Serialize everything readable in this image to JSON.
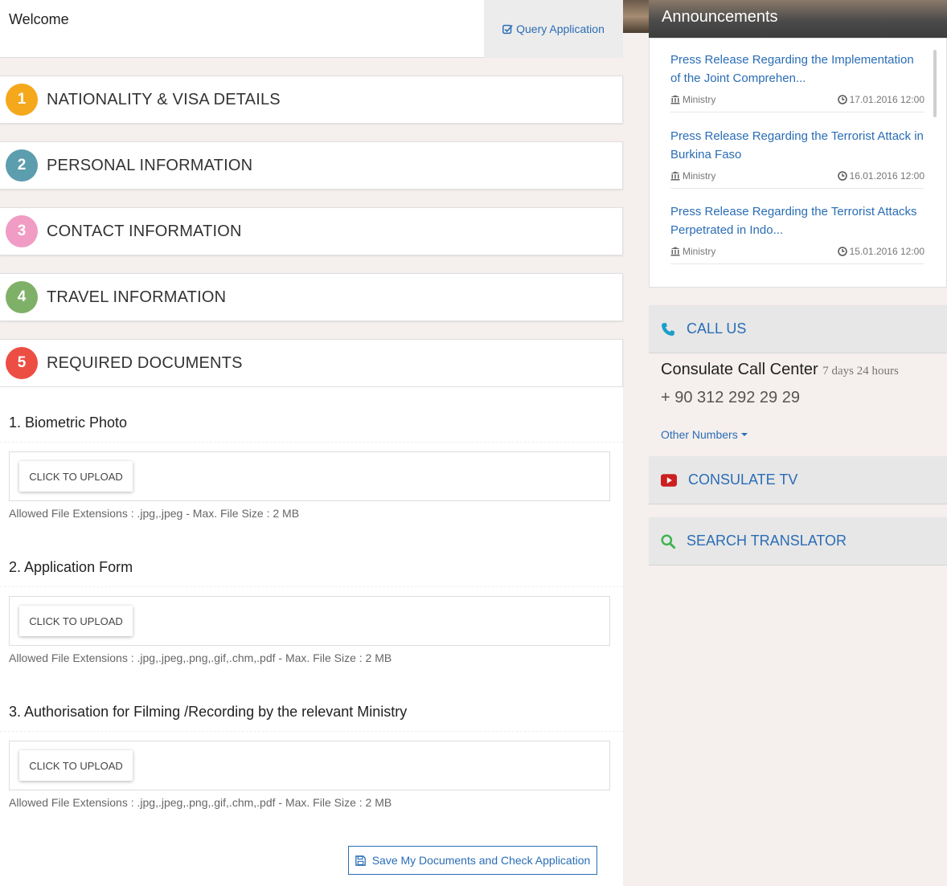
{
  "header": {
    "welcome": "Welcome",
    "query_label": "Query Application"
  },
  "steps": [
    {
      "number": "1",
      "label": "NATIONALITY & VISA DETAILS",
      "color": "#f5a81c"
    },
    {
      "number": "2",
      "label": "PERSONAL INFORMATION",
      "color": "#5c9dae"
    },
    {
      "number": "3",
      "label": "CONTACT INFORMATION",
      "color": "#f09cc4"
    },
    {
      "number": "4",
      "label": "TRAVEL INFORMATION",
      "color": "#7fb068"
    },
    {
      "number": "5",
      "label": "REQUIRED DOCUMENTS",
      "color": "#ec4e43"
    }
  ],
  "documents": [
    {
      "title": "1. Biometric Photo",
      "button": "CLICK TO UPLOAD",
      "allowed": "Allowed File Extensions : .jpg,.jpeg - Max. File Size : 2 MB"
    },
    {
      "title": "2. Application Form",
      "button": "CLICK TO UPLOAD",
      "allowed": "Allowed File Extensions : .jpg,.jpeg,.png,.gif,.chm,.pdf - Max. File Size : 2 MB"
    },
    {
      "title": "3. Authorisation for Filming /Recording by the relevant Ministry",
      "button": "CLICK TO UPLOAD",
      "allowed": "Allowed File Extensions : .jpg,.jpeg,.png,.gif,.chm,.pdf - Max. File Size : 2 MB"
    }
  ],
  "save_label": "Save My Documents and Check Application",
  "announcements": {
    "title": "Announcements",
    "items": [
      {
        "text": "Press Release Regarding the Implementation of the Joint Comprehen...",
        "source": "Ministry",
        "date": "17.01.2016 12:00"
      },
      {
        "text": "Press Release Regarding the Terrorist Attack in Burkina Faso",
        "source": "Ministry",
        "date": "16.01.2016 12:00"
      },
      {
        "text": "Press Release Regarding the Terrorist Attacks Perpetrated in Indo...",
        "source": "Ministry",
        "date": "15.01.2016 12:00"
      }
    ]
  },
  "call_us": {
    "title": "CALL US",
    "center": "Consulate Call Center",
    "hours": "7 days 24 hours",
    "phone": "+ 90 312 292 29 29",
    "other": "Other Numbers"
  },
  "consulate_tv": "CONSULATE TV",
  "search_translator": "SEARCH TRANSLATOR",
  "colors": {
    "link": "#2a6db5",
    "phone_icon": "#1a9fc9",
    "tv_icon": "#cc1f1f",
    "search_icon": "#3fb34f"
  }
}
